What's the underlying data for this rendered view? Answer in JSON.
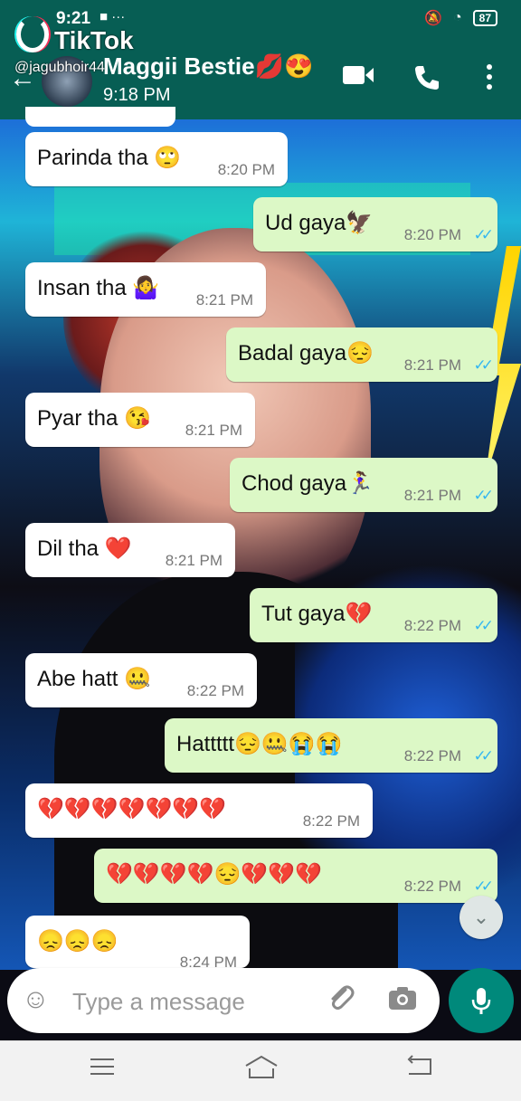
{
  "status_bar": {
    "time": "9:21",
    "left_icons": "■ ···",
    "battery": "87"
  },
  "overlay": {
    "brand": "TikTok",
    "handle": "@jagubhoir44"
  },
  "header": {
    "contact_name": "Maggii Bestie💋😍",
    "subtitle": "9:18 PM"
  },
  "messages": [
    {
      "dir": "in",
      "text": "Parinda tha 🙄",
      "time": "8:20 PM"
    },
    {
      "dir": "out",
      "text": "Ud gaya🦅",
      "time": "8:20 PM"
    },
    {
      "dir": "in",
      "text": "Insan tha 🤷‍♀️",
      "time": "8:21 PM"
    },
    {
      "dir": "out",
      "text": "Badal gaya😔",
      "time": "8:21 PM"
    },
    {
      "dir": "in",
      "text": "Pyar tha 😘",
      "time": "8:21 PM"
    },
    {
      "dir": "out",
      "text": "Chod gaya🏃‍♀️",
      "time": "8:21 PM"
    },
    {
      "dir": "in",
      "text": "Dil tha ❤️",
      "time": "8:21 PM"
    },
    {
      "dir": "out",
      "text": "Tut gaya💔",
      "time": "8:22 PM"
    },
    {
      "dir": "in",
      "text": "Abe hatt 🤐",
      "time": "8:22 PM"
    },
    {
      "dir": "out",
      "text": "Hattttt😔🤐😭😭",
      "time": "8:22 PM"
    },
    {
      "dir": "in",
      "text": "💔💔💔💔💔💔💔",
      "time": "8:22 PM"
    },
    {
      "dir": "out",
      "text": "💔💔💔💔😔💔💔💔",
      "time": "8:22 PM"
    },
    {
      "dir": "in",
      "text": "😞😞😞",
      "time": "8:24 PM"
    }
  ],
  "compose": {
    "placeholder": "Type a message"
  },
  "icons": {
    "back": "arrow-left-icon",
    "video": "video-call-icon",
    "call": "phone-icon",
    "more": "more-vert-icon",
    "emoji": "emoji-icon",
    "attach": "paperclip-icon",
    "camera": "camera-icon",
    "mic": "mic-icon",
    "scroll": "chevron-double-down-icon"
  },
  "colors": {
    "header": "#075e54",
    "incoming": "#ffffff",
    "outgoing": "#dcf8c6",
    "tick": "#34b7f1",
    "mic": "#00897b"
  }
}
